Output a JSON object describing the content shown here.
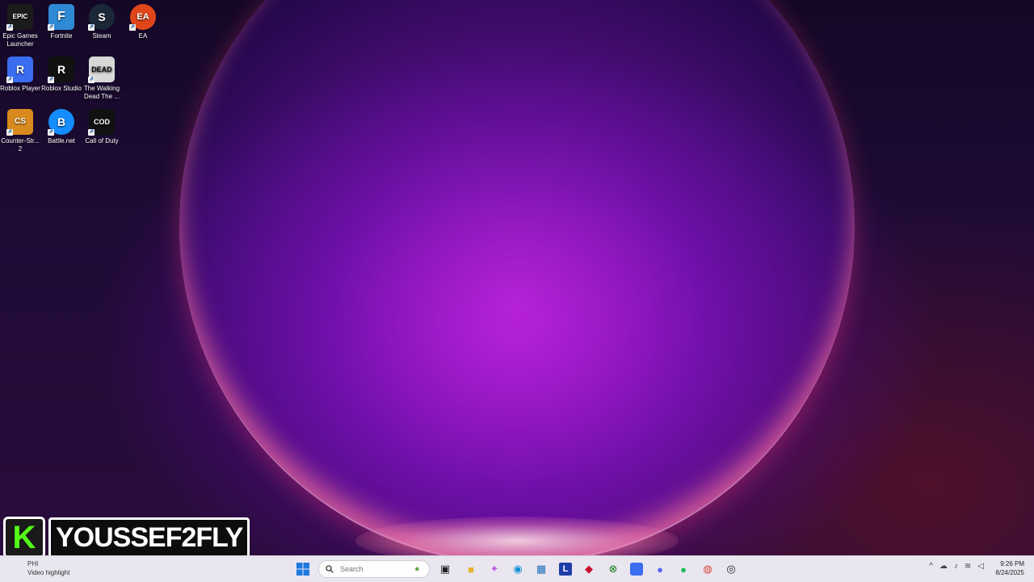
{
  "desktop": {
    "icons": [
      {
        "label": "Epic Games Launcher",
        "tile_text": "EPIC",
        "color": "#1b1b1b"
      },
      {
        "label": "Fortnite",
        "tile_text": "F",
        "color": "#2f8ad6"
      },
      {
        "label": "Steam",
        "tile_text": "S",
        "color": "#1b2838"
      },
      {
        "label": "EA",
        "tile_text": "EA",
        "color": "#e0461a"
      },
      {
        "label": "Roblox Player",
        "tile_text": "R",
        "color": "#3a6df0"
      },
      {
        "label": "Roblox Studio",
        "tile_text": "R",
        "color": "#111111"
      },
      {
        "label": "The Walking Dead The ...",
        "tile_text": "DEAD",
        "color": "#d8d8d8"
      },
      {
        "label": "Counter-Str... 2",
        "tile_text": "CS",
        "color": "#d98a1e"
      },
      {
        "label": "Battle.net",
        "tile_text": "B",
        "color": "#148eff"
      },
      {
        "label": "Call of Duty",
        "tile_text": "COD",
        "color": "#111111"
      }
    ]
  },
  "watermark": {
    "logo_letter": "K",
    "name": "YOUSSEF2FLY"
  },
  "taskbar": {
    "weather_top": "PHI",
    "weather_sub": "Video highlight",
    "search_placeholder": "Search",
    "clock_time": "9:26 PM",
    "clock_date": "8/24/2025",
    "pinned_icons": [
      "start-icon",
      "task-view-icon",
      "file-explorer-icon",
      "copilot-icon",
      "edge-icon",
      "store-icon",
      "l-app-icon",
      "mcafee-icon",
      "xbox-icon",
      "roblox-icon",
      "discord-icon",
      "spotify-icon",
      "chrome-icon",
      "capture-icon"
    ]
  },
  "colors": {
    "accent": "#53fc18",
    "taskbar_bg": "#e9e6ef"
  }
}
